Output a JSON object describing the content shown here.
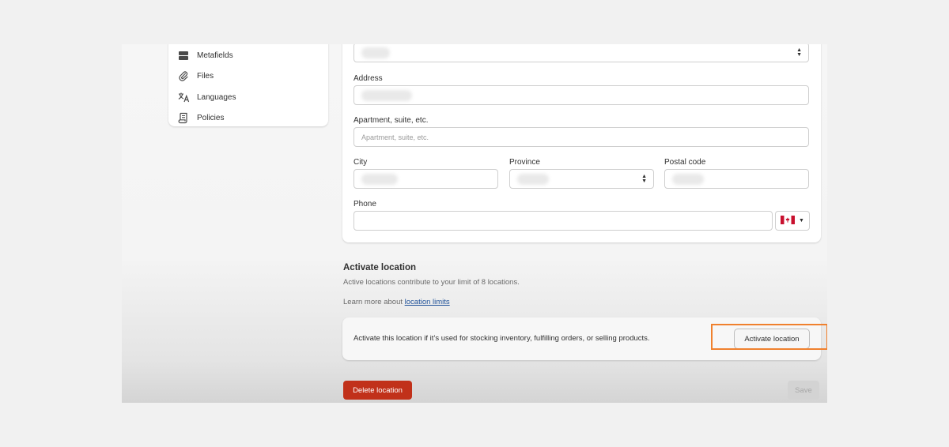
{
  "sidebar": {
    "items": [
      {
        "label": "Metafields",
        "icon": "metafields-icon"
      },
      {
        "label": "Files",
        "icon": "paperclip-icon"
      },
      {
        "label": "Languages",
        "icon": "translate-icon"
      },
      {
        "label": "Policies",
        "icon": "policy-document-icon"
      }
    ]
  },
  "form": {
    "address_label": "Address",
    "apartment_label": "Apartment, suite, etc.",
    "apartment_placeholder": "Apartment, suite, etc.",
    "city_label": "City",
    "province_label": "Province",
    "postal_label": "Postal code",
    "phone_label": "Phone",
    "phone_country": "Canada"
  },
  "activate": {
    "title": "Activate location",
    "description": "Active locations contribute to your limit of 8 locations.",
    "learn_prefix": "Learn more about ",
    "learn_link": "location limits",
    "card_text": "Activate this location if it’s used for stocking inventory, fulfilling orders, or selling products.",
    "button_label": "Activate location"
  },
  "footer": {
    "delete_label": "Delete location",
    "save_label": "Save"
  },
  "colors": {
    "highlight": "#f0812e",
    "danger": "#c1311a",
    "link": "#1f5199"
  }
}
